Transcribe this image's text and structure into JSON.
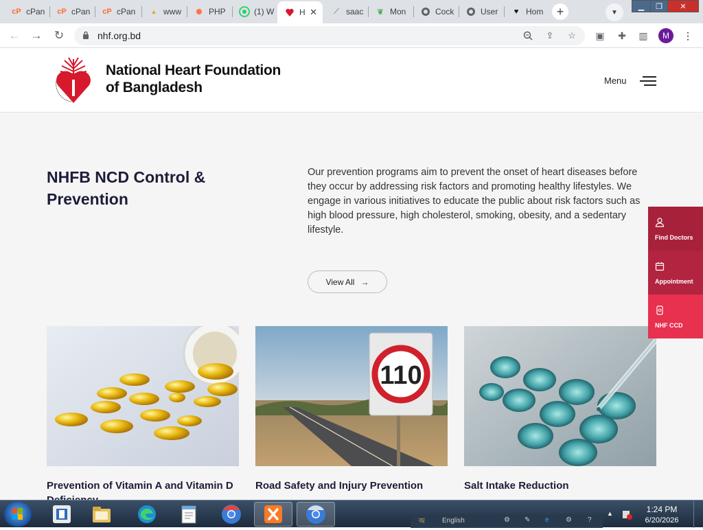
{
  "browser": {
    "tabs": [
      {
        "title": "cPan",
        "icon": "cpanel-icon"
      },
      {
        "title": "cPan",
        "icon": "cpanel-icon"
      },
      {
        "title": "cPan",
        "icon": "cpanel-icon"
      },
      {
        "title": "www",
        "icon": "pma-icon"
      },
      {
        "title": "PHP",
        "icon": "php-icon"
      },
      {
        "title": "(1) W",
        "icon": "whatsapp-icon"
      },
      {
        "title": "H",
        "icon": "heart-logo-icon",
        "active": true
      },
      {
        "title": "saac",
        "icon": "chart-icon"
      },
      {
        "title": "Mon",
        "icon": "mongodb-icon"
      },
      {
        "title": "Cock",
        "icon": "globe-icon"
      },
      {
        "title": "User",
        "icon": "globe-icon"
      },
      {
        "title": "Hom",
        "icon": "heart-icon"
      }
    ],
    "address": "nhf.org.bd",
    "profile_initial": "M"
  },
  "site": {
    "org_name_line1": "National Heart Foundation",
    "org_name_line2": "of Bangladesh",
    "menu_label": "Menu",
    "section_title": "NHFB NCD Control & Prevention",
    "section_description": "Our prevention programs aim to prevent the onset of heart diseases before they occur by addressing risk factors and promoting healthy lifestyles. We engage in various initiatives to educate the public about risk factors such as high blood pressure, high cholesterol, smoking, obesity, and a sedentary lifestyle.",
    "view_all_label": "View All",
    "cards": [
      {
        "title": "Prevention of Vitamin A and Vitamin D Deficiency",
        "image": "vitamin-capsules"
      },
      {
        "title": "Road Safety and Injury Prevention",
        "image": "speed-sign-110",
        "sign_text": "110"
      },
      {
        "title": "Salt Intake Reduction",
        "image": "lab-pipette"
      }
    ],
    "floating_buttons": [
      {
        "label": "Find Doctors",
        "color": "#a8213a"
      },
      {
        "label": "Appointment",
        "color": "#b22440"
      },
      {
        "label": "NHF CCD",
        "color": "#e8304f"
      }
    ],
    "brand_color": "#d7192e"
  },
  "taskbar": {
    "language": "English",
    "time": "1:24 PM",
    "date": "6/20/2026"
  }
}
